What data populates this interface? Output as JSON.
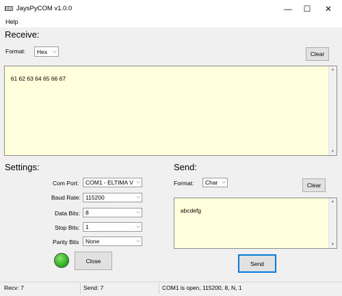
{
  "window": {
    "title": "JaysPyCOM v1.0.0",
    "minimize_glyph": "—",
    "maximize_glyph": "☐",
    "close_glyph": "✕"
  },
  "menu": {
    "help": "Help"
  },
  "receive": {
    "title": "Receive:",
    "format_label": "Format:",
    "format_value": "Hex",
    "clear_label": "Clear",
    "text": "61 62 63 64 65 66 67"
  },
  "settings": {
    "title": "Settings:",
    "com_port_label": "Com Port:",
    "com_port_value": "COM1 - ELTIMA V",
    "baud_rate_label": "Baud Rate:",
    "baud_rate_value": "115200",
    "data_bits_label": "Data Bits:",
    "data_bits_value": "8",
    "stop_bits_label": "Stop Bits:",
    "stop_bits_value": "1",
    "parity_bits_label": "Parity Bits",
    "parity_bits_value": "None",
    "close_label": "Close",
    "led_color": "#34b626"
  },
  "send": {
    "title": "Send:",
    "format_label": "Format:",
    "format_value": "Char",
    "clear_label": "Clear",
    "text": "abcdefg",
    "send_label": "Send"
  },
  "status": {
    "recv": "Recv: 7",
    "send": "Send: 7",
    "port_status": "COM1 is open, 115200, 8, N, 1"
  },
  "icons": {
    "app": "serial-port-icon",
    "dropdown": "chevron-down-icon",
    "scroll_up": "arrow-up-icon",
    "scroll_down": "arrow-down-icon"
  }
}
